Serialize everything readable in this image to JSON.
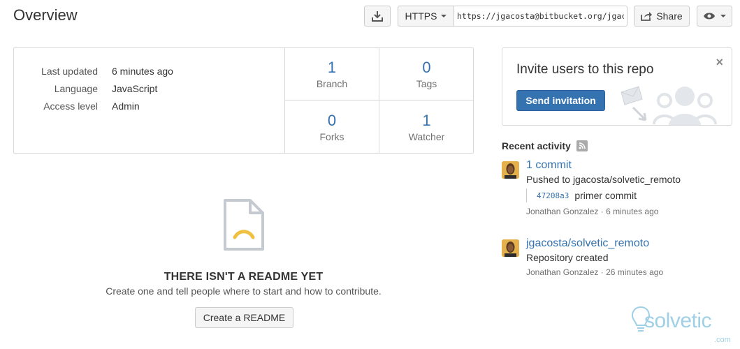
{
  "header": {
    "title": "Overview",
    "protocol_label": "HTTPS",
    "clone_url": "https://jgacosta@bitbucket.org/jgacosta/solvetic_remoto.git",
    "share_label": "Share"
  },
  "repo_info": {
    "rows": [
      {
        "label": "Last updated",
        "value": "6 minutes ago"
      },
      {
        "label": "Language",
        "value": "JavaScript"
      },
      {
        "label": "Access level",
        "value": "Admin"
      }
    ]
  },
  "stats": [
    {
      "num": "1",
      "label": "Branch"
    },
    {
      "num": "0",
      "label": "Tags"
    },
    {
      "num": "0",
      "label": "Forks"
    },
    {
      "num": "1",
      "label": "Watcher"
    }
  ],
  "readme": {
    "title": "THERE ISN'T A README YET",
    "subtitle": "Create one and tell people where to start and how to contribute.",
    "create_label": "Create a README"
  },
  "invite": {
    "title": "Invite users to this repo",
    "send_label": "Send invitation",
    "close_glyph": "×"
  },
  "activity": {
    "title": "Recent activity",
    "items": [
      {
        "link": "1 commit",
        "text": "Pushed to jgacosta/solvetic_remoto",
        "commit_hash": "47208a3",
        "commit_msg": "primer commit",
        "meta": "Jonathan Gonzalez · 6 minutes ago"
      },
      {
        "link": "jgacosta/solvetic_remoto",
        "text": "Repository created",
        "meta": "Jonathan Gonzalez · 26 minutes ago"
      }
    ]
  },
  "watermark": {
    "text": "solvetic",
    "suffix": ".com"
  },
  "colors": {
    "link": "#3572b0",
    "primary_button": "#3572b0",
    "readme_frown": "#f0c040",
    "watermark": "#9fd0e6"
  }
}
